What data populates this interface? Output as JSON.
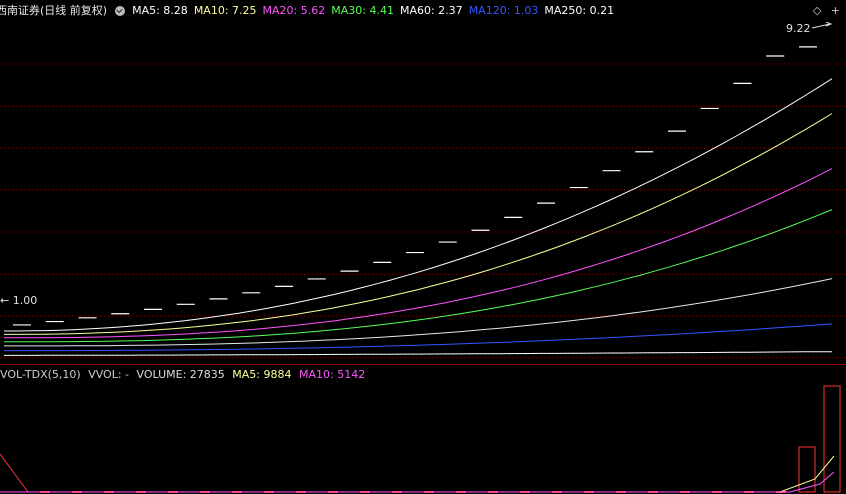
{
  "header": {
    "stock_name": "西南证券(日线 前复权)",
    "ma_items": [
      {
        "text": "MA5: 8.28",
        "color": "#ffffff"
      },
      {
        "text": "MA10: 7.25",
        "color": "#ffff99"
      },
      {
        "text": "MA20: 5.62",
        "color": "#ff55ff"
      },
      {
        "text": "MA30: 4.41",
        "color": "#55ff55"
      },
      {
        "text": "MA60: 2.37",
        "color": "#ffffff"
      },
      {
        "text": "MA120: 1.03",
        "color": "#3355ff"
      },
      {
        "text": "MA250: 0.21",
        "color": "#ffffff"
      }
    ],
    "diamond_icon": "◇",
    "plus_icon": "+"
  },
  "price_panel": {
    "high_label": "9.22",
    "low_label": "1.00",
    "daily_closes": [
      1.0,
      1.1,
      1.21,
      1.33,
      1.46,
      1.61,
      1.77,
      1.95,
      2.14,
      2.36,
      2.59,
      2.85,
      3.14,
      3.45,
      3.8,
      4.18,
      4.6,
      5.06,
      5.56,
      6.12,
      6.73,
      7.4,
      8.14,
      8.95,
      9.22
    ]
  },
  "volume_panel": {
    "indicator_label": "VOL-TDX(5,10)",
    "vvol_label": "VVOL: -",
    "volume_label": "VOLUME: 27835",
    "ma5_label": "MA5: 9884",
    "ma10_label": "MA10: 5142"
  },
  "colors": {
    "ma5": "#ffffff",
    "ma10": "#ffff99",
    "ma20": "#ff55ff",
    "ma30": "#55ff55",
    "ma60": "#e8e8e8",
    "ma120": "#3355ff",
    "ma250": "#ffffff",
    "grid": "#8b0000",
    "candle": "#ffffff",
    "volume": "#ff3333"
  }
}
